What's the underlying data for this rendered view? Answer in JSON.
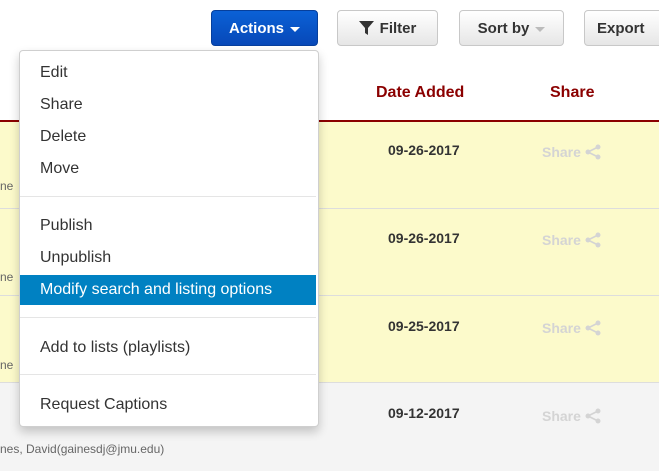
{
  "toolbar": {
    "actions_label": "Actions",
    "filter_label": "Filter",
    "sortby_label": "Sort by",
    "export_label": "Export"
  },
  "table": {
    "headers": {
      "date_added": "Date Added",
      "share": "Share"
    },
    "rows": [
      {
        "date": "09-26-2017",
        "share": "Share",
        "owner": "ne",
        "highlight": true
      },
      {
        "date": "09-26-2017",
        "share": "Share",
        "owner": "ne",
        "highlight": true
      },
      {
        "date": "09-25-2017",
        "share": "Share",
        "owner": "ne",
        "highlight": true
      },
      {
        "date": "09-12-2017",
        "share": "Share",
        "owner": "nes, David(gainesdj@jmu.edu)",
        "highlight": false
      }
    ]
  },
  "menu": {
    "items": [
      {
        "label": "Edit"
      },
      {
        "label": "Share"
      },
      {
        "label": "Delete"
      },
      {
        "label": "Move"
      },
      {
        "label": "Publish"
      },
      {
        "label": "Unpublish"
      },
      {
        "label": "Modify search and listing options",
        "active": true
      },
      {
        "label": "Add to lists (playlists)"
      },
      {
        "label": "Request Captions"
      }
    ]
  },
  "colors": {
    "primary": "#0748b8",
    "header_text": "#8b0000",
    "row_highlight": "#fcfacb",
    "menu_active": "#0081c2"
  },
  "icons": [
    "caret-down-icon",
    "filter-funnel-icon",
    "share-nodes-icon"
  ]
}
